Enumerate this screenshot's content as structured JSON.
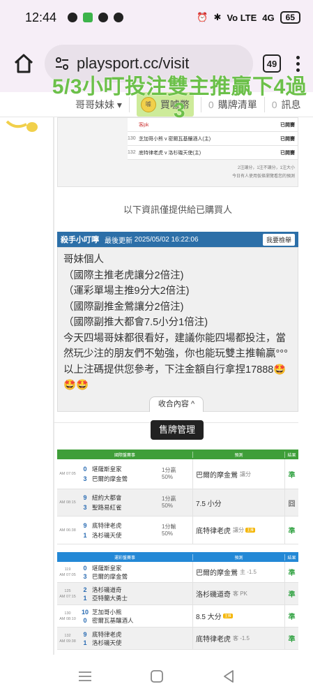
{
  "status_bar": {
    "time": "12:44",
    "signal": "4G",
    "volte": "Vo LTE",
    "battery": "65"
  },
  "browser": {
    "url": "playsport.cc/visit",
    "tab_count": "49"
  },
  "overlay_caption": "5/3小叮投注雙主推贏下4過3",
  "site_nav": {
    "user_menu": "哥哥妹妹 ▾",
    "buy_coin": "買噱幣",
    "cart_count": "0",
    "cart_label": "購牌清單",
    "msg_count": "0",
    "msg_label": "訊息"
  },
  "prev_table": {
    "rows": [
      {
        "no": "",
        "teams": "客pk",
        "status": "已開賽",
        "pk": "客PK"
      },
      {
        "no": "130",
        "teams": "芝加哥小熊 v 密爾瓦基釀酒人(主)",
        "status": "已開賽"
      },
      {
        "no": "132",
        "teams": "底特律老虎 v 洛杉磯天使(主)",
        "status": "已開賽"
      }
    ],
    "foot1": "2注讓分，1注不讓分，1注大小",
    "foot2": "今日有人使用仮條瀏覽看您的預測"
  },
  "info_note": "以下資訊僅提供給已購買人",
  "post": {
    "author": "殺手小叮嚀",
    "updated_label": "最後更新",
    "updated": "2025/05/02 16:22:06",
    "report": "我要檢舉",
    "body": "哥妹個人\n（國際主推老虎讓分2倍注)\n（運彩單場主推9分大2倍注)\n（國際副推金鶯讓分2倍注)\n（國際副推大都會7.5小分1倍注)\n今天四場哥妹都很看好，建議你能四場都投注，當然玩少注的朋友們不勉強，你也能玩雙主推輸贏°°°以上注碼提供您參考，下注金額自行拿捏17888🤩🤩🤩",
    "collapse": "收合內容 ^"
  },
  "sale_button": "售牌管理",
  "intl_table": {
    "headers": [
      "國際盤賽事",
      "預測",
      "結果"
    ],
    "rows": [
      {
        "time": "AM 07:05",
        "away_score": "0",
        "away": "堪薩斯皇家",
        "home_score": "3",
        "home": "巴爾的摩金鶯",
        "line1": "1分贏",
        "line2": "50%",
        "pick": "巴爾的摩金鶯",
        "pick_sub": "讓分",
        "result": "準",
        "tag": ""
      },
      {
        "time": "AM 08:15",
        "away_score": "9",
        "away": "紐約大都會",
        "home_score": "3",
        "home": "聖路易紅雀",
        "line1": "1分贏",
        "line2": "50%",
        "pick": "7.5 小分",
        "pick_sub": "",
        "result": "囧",
        "tag": ""
      },
      {
        "time": "AM 06:38",
        "away_score": "9",
        "away": "底特律老虎",
        "home_score": "1",
        "home": "洛杉磯天使",
        "line1": "1分輸",
        "line2": "50%",
        "pick": "底特律老虎",
        "pick_sub": "讓分",
        "result": "準",
        "tag": "主推"
      }
    ]
  },
  "sport_table": {
    "headers": [
      "運彩盤賽事",
      "預測",
      "結果"
    ],
    "rows": [
      {
        "no": "119",
        "time": "AM 07:05",
        "away_score": "0",
        "away": "堪薩斯皇家",
        "home_score": "3",
        "home": "巴爾的摩金鶯",
        "pick": "巴爾的摩金鶯",
        "pick_sub": "主 -1.5",
        "result": "準",
        "tag": ""
      },
      {
        "no": "125",
        "time": "AM 07:15",
        "away_score": "2",
        "away": "洛杉磯道奇",
        "home_score": "1",
        "home": "亞特蘭大勇士",
        "pick": "洛杉磯道奇",
        "pick_sub": "客 PK",
        "result": "準",
        "tag": ""
      },
      {
        "no": "130",
        "time": "AM 08:10",
        "away_score": "10",
        "away": "芝加哥小熊",
        "home_score": "0",
        "home": "密爾瓦基釀酒人",
        "pick": "8.5 大分",
        "pick_sub": "",
        "result": "準",
        "tag": "主推"
      },
      {
        "no": "132",
        "time": "AM 09:38",
        "away_score": "9",
        "away": "底特律老虎",
        "home_score": "1",
        "home": "洛杉磯天使",
        "pick": "底特律老虎",
        "pick_sub": "客 -1.5",
        "result": "準",
        "tag": ""
      }
    ]
  }
}
